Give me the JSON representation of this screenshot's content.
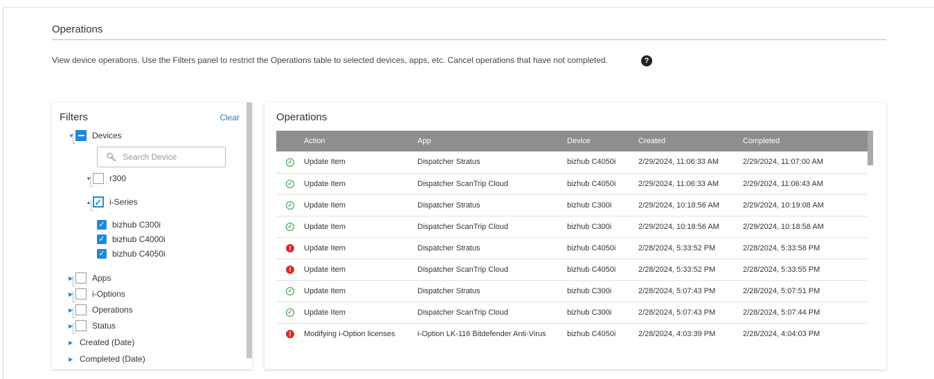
{
  "page": {
    "title": "Operations",
    "description": "View device operations. Use the Filters panel to restrict the Operations table to selected devices, apps, etc. Cancel operations that have not completed.",
    "help_icon": "?"
  },
  "filters": {
    "title": "Filters",
    "clear_label": "Clear",
    "devices_label": "Devices",
    "search_placeholder": "Search Device",
    "search_value": "",
    "groups": [
      {
        "label": "r300",
        "state": "unchecked",
        "expanded": false
      },
      {
        "label": "i-Series",
        "state": "checked",
        "expanded": true
      }
    ],
    "devices": [
      {
        "label": "bizhub C300i",
        "checked": true
      },
      {
        "label": "bizhub C4000i",
        "checked": true
      },
      {
        "label": "bizhub C4050i",
        "checked": true
      }
    ],
    "categories": [
      {
        "label": "Apps",
        "has_checkbox": true
      },
      {
        "label": "i-Options",
        "has_checkbox": true
      },
      {
        "label": "Operations",
        "has_checkbox": true
      },
      {
        "label": "Status",
        "has_checkbox": true
      },
      {
        "label": "Created (Date)",
        "has_checkbox": false
      },
      {
        "label": "Completed (Date)",
        "has_checkbox": false
      }
    ]
  },
  "operations": {
    "title": "Operations",
    "columns": [
      "",
      "Action",
      "App",
      "Device",
      "Created",
      "Completed"
    ],
    "rows": [
      {
        "status": "success",
        "action": "Update Item",
        "app": "Dispatcher Stratus",
        "device": "bizhub C4050i",
        "created": "2/29/2024, 11:06:33 AM",
        "completed": "2/29/2024, 11:07:00 AM"
      },
      {
        "status": "success",
        "action": "Update Item",
        "app": "Dispatcher ScanTrip Cloud",
        "device": "bizhub C4050i",
        "created": "2/29/2024, 11:06:33 AM",
        "completed": "2/29/2024, 11:06:43 AM"
      },
      {
        "status": "success",
        "action": "Update Item",
        "app": "Dispatcher Stratus",
        "device": "bizhub C300i",
        "created": "2/29/2024, 10:18:56 AM",
        "completed": "2/29/2024, 10:19:08 AM"
      },
      {
        "status": "success",
        "action": "Update Item",
        "app": "Dispatcher ScanTrip Cloud",
        "device": "bizhub C300i",
        "created": "2/29/2024, 10:18:56 AM",
        "completed": "2/29/2024, 10:18:58 AM"
      },
      {
        "status": "error",
        "action": "Update Item",
        "app": "Dispatcher Stratus",
        "device": "bizhub C4050i",
        "created": "2/28/2024, 5:33:52 PM",
        "completed": "2/28/2024, 5:33:58 PM"
      },
      {
        "status": "error",
        "action": "Update Item",
        "app": "Dispatcher ScanTrip Cloud",
        "device": "bizhub C4050i",
        "created": "2/28/2024, 5:33:52 PM",
        "completed": "2/28/2024, 5:33:55 PM"
      },
      {
        "status": "success",
        "action": "Update Item",
        "app": "Dispatcher Stratus",
        "device": "bizhub C300i",
        "created": "2/28/2024, 5:07:43 PM",
        "completed": "2/28/2024, 5:07:51 PM"
      },
      {
        "status": "success",
        "action": "Update Item",
        "app": "Dispatcher ScanTrip Cloud",
        "device": "bizhub C300i",
        "created": "2/28/2024, 5:07:43 PM",
        "completed": "2/28/2024, 5:07:44 PM"
      },
      {
        "status": "error",
        "action": "Modifying i-Option licenses",
        "app": "i-Option LK-116 Bitdefender Anti-Virus",
        "device": "bizhub C4050i",
        "created": "2/28/2024, 4:03:39 PM",
        "completed": "2/28/2024, 4:04:03 PM"
      }
    ]
  },
  "colors": {
    "accent": "#1e8ad6",
    "success": "#2a9d3a",
    "error": "#d92c2c",
    "table_header": "#8e8e8e"
  }
}
